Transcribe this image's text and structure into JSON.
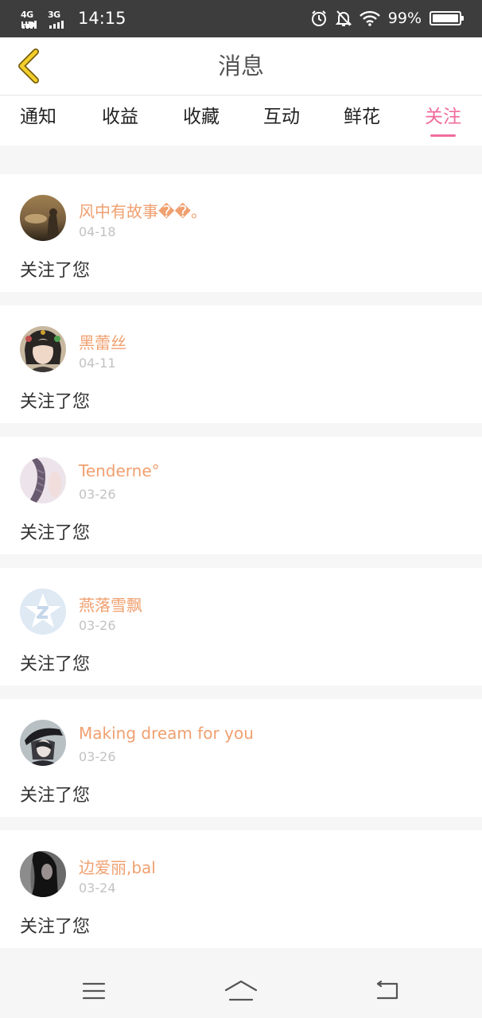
{
  "status_bar": {
    "network_1": "4G HD",
    "network_2": "3G",
    "time": "14:15",
    "battery_percent": "99%",
    "battery_level": 0.99
  },
  "header": {
    "title": "消息",
    "back_icon": "chevron-left-icon"
  },
  "tabs": [
    {
      "label": "通知",
      "active": false
    },
    {
      "label": "收益",
      "active": false
    },
    {
      "label": "收藏",
      "active": false
    },
    {
      "label": "互动",
      "active": false
    },
    {
      "label": "鲜花",
      "active": false
    },
    {
      "label": "关注",
      "active": true
    }
  ],
  "notifications": [
    {
      "username": "风中有故事��。",
      "date": "04-18",
      "message": "关注了您"
    },
    {
      "username": "黑蕾丝",
      "date": "04-11",
      "message": "关注了您"
    },
    {
      "username": "Tenderne°",
      "date": "03-26",
      "message": "关注了您"
    },
    {
      "username": "燕落雪飘",
      "date": "03-26",
      "message": "关注了您"
    },
    {
      "username": "Making dream for you",
      "date": "03-26",
      "message": "关注了您"
    },
    {
      "username": "边爱丽,bal",
      "date": "03-24",
      "message": "关注了您"
    }
  ],
  "nav_bar": {
    "menu_icon": "menu-icon",
    "home_icon": "home-icon",
    "back_icon": "back-icon"
  },
  "colors": {
    "accent": "#f06c9d",
    "username": "#f0a070",
    "back_arrow": "#e8c020"
  }
}
